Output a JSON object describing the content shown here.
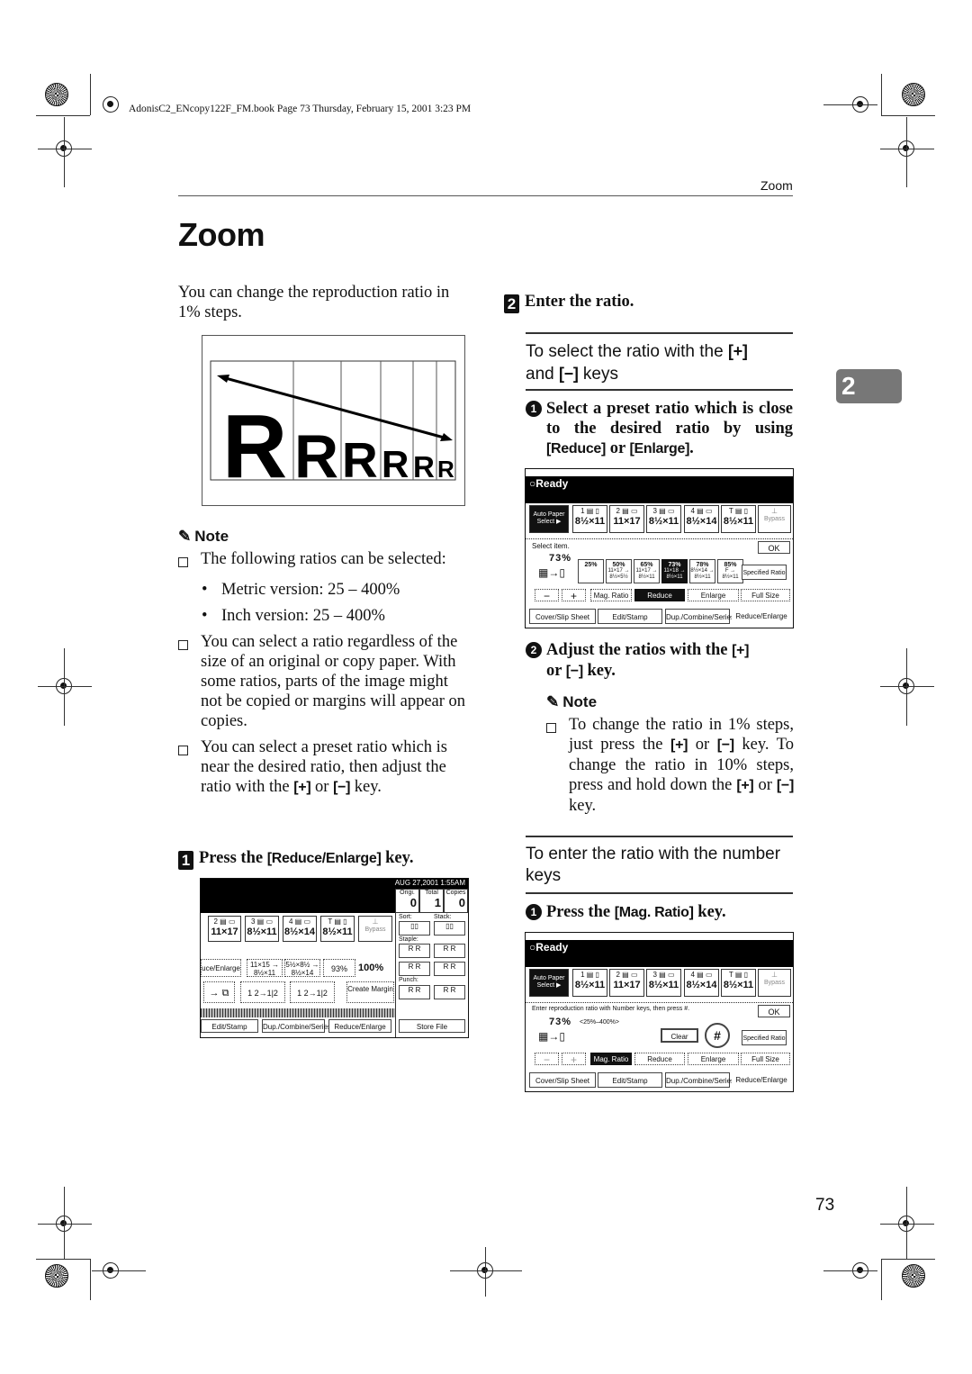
{
  "page": {
    "header_meta": "AdonisC2_ENcopy122F_FM.book  Page 73  Thursday, February 15, 2001  3:23 PM",
    "running_head": "Zoom",
    "title": "Zoom",
    "chapter_tab": "2",
    "page_number": "73"
  },
  "left": {
    "intro": "You can change the reproduction ratio in 1% steps.",
    "figure": {
      "letters": [
        "R",
        "R",
        "R",
        "R",
        "R",
        "R"
      ],
      "icon": "double-arrow-icon"
    },
    "note": {
      "heading": "Note",
      "items": [
        {
          "text": "The following ratios can be selected:",
          "bullets": [
            "Metric version: 25 – 400%",
            "Inch version: 25 – 400%"
          ]
        },
        {
          "text": "You can select a ratio regardless of the size of an original or copy paper. With some ratios, parts of the image might not be copied or margins will appear on copies."
        },
        {
          "pre": "You can select a preset ratio which is near the desired ratio, then adjust the ratio with the ",
          "plus": "[+]",
          "mid": " or ",
          "minus": "[−]",
          "post": " key."
        }
      ]
    },
    "step1": {
      "num": "1",
      "pre": "Press the ",
      "key": "[Reduce/Enlarge]",
      "post": " key."
    },
    "panel1": {
      "date": "AUG  27,2001   1:55AM",
      "counters": [
        {
          "label": "Origi.",
          "value": "0"
        },
        {
          "label": "Total",
          "value": "1"
        },
        {
          "label": "Copies",
          "value": "0"
        }
      ],
      "trays": [
        {
          "id": "2",
          "size": "11×17"
        },
        {
          "id": "3",
          "size": "8½×11"
        },
        {
          "id": "4",
          "size": "8½×14"
        },
        {
          "id": "T",
          "size": "8½×11"
        },
        {
          "id": "",
          "size": "Bypass"
        }
      ],
      "ratio_row": [
        "uce/Enlarge",
        "11×15 → 8½×11",
        "5½×8½ → 8½×14",
        "93%",
        "100%"
      ],
      "func_row": [
        "Create Margin"
      ],
      "sort_label": "Sort:",
      "stack_label": "Stack:",
      "staple_label": "Staple:",
      "punch_label": "Punch:",
      "tabs": [
        "Edit/Stamp",
        "Dup./Combine/Series",
        "Reduce/Enlarge"
      ],
      "store": "Store File"
    }
  },
  "right": {
    "step2": {
      "num": "2",
      "text": "Enter the ratio."
    },
    "section1": {
      "heading_pre": "To select the ratio with the ",
      "plus": "[+]",
      "heading_mid": " and ",
      "minus": "[−]",
      "heading_post": " keys",
      "sub1": {
        "num": "1",
        "pre": "Select a preset ratio which is close to the desired ratio by using ",
        "k1": "[Reduce]",
        "mid": " or ",
        "k2": "[Enlarge]",
        "post": "."
      },
      "sub2": {
        "num": "2",
        "pre": "Adjust the ratios with the ",
        "plus": "[+]",
        "mid": " or ",
        "minus": "[−]",
        "post": " key."
      },
      "note": {
        "heading": "Note",
        "text_parts": [
          "To change the ratio in 1% steps, just press the ",
          "[+]",
          " or ",
          "[−]",
          " key. To change the ratio in 10% steps, press and hold down the ",
          "[+]",
          " or ",
          "[−]",
          " key."
        ]
      }
    },
    "section2": {
      "heading": "To enter the ratio with the number keys",
      "sub1": {
        "num": "1",
        "pre": "Press the ",
        "key": "[Mag. Ratio]",
        "post": " key."
      }
    },
    "panel2": {
      "status": "Ready",
      "auto_paper": "Auto Paper Select ▶",
      "trays": [
        {
          "id": "1",
          "size": "8½×11"
        },
        {
          "id": "2",
          "size": "11×17"
        },
        {
          "id": "3",
          "size": "8½×11"
        },
        {
          "id": "4",
          "size": "8½×14"
        },
        {
          "id": "T",
          "size": "8½×11"
        },
        {
          "id": "",
          "size": "Bypass"
        }
      ],
      "prompt": "Select item.",
      "ok": "OK",
      "ratio": "73%",
      "presets": [
        {
          "pct": "25%",
          "sub": ""
        },
        {
          "pct": "50%",
          "sub": "11×17 → 8½×5½"
        },
        {
          "pct": "65%",
          "sub": "11×17 → 8½×11"
        },
        {
          "pct": "73%",
          "sub": "11×18 → 8½×11",
          "selected": true
        },
        {
          "pct": "78%",
          "sub": "8½×14 → 8½×11"
        },
        {
          "pct": "85%",
          "sub": "F → 8½×11"
        }
      ],
      "specified": "Specified Ratio",
      "minus": "−",
      "plus": "+",
      "mode_buttons": [
        "Mag. Ratio",
        "Reduce",
        "Enlarge",
        "Full Size"
      ],
      "active_mode": "Reduce",
      "tabs": [
        "Cover/Slip Sheet",
        "Edit/Stamp",
        "Dup./Combine/Series",
        "Reduce/Enlarge"
      ]
    },
    "panel3": {
      "status": "Ready",
      "auto_paper": "Auto Paper Select ▶",
      "trays": [
        {
          "id": "1",
          "size": "8½×11"
        },
        {
          "id": "2",
          "size": "11×17"
        },
        {
          "id": "3",
          "size": "8½×11"
        },
        {
          "id": "4",
          "size": "8½×14"
        },
        {
          "id": "T",
          "size": "8½×11"
        },
        {
          "id": "",
          "size": "Bypass"
        }
      ],
      "prompt": "Enter reproduction ratio with Number keys, then press #.",
      "ok": "OK",
      "ratio": "73%",
      "range": "<25%–400%>",
      "clear": "Clear",
      "hash": "#",
      "specified": "Specified Ratio",
      "minus": "−",
      "plus": "+",
      "mode_buttons": [
        "Mag. Ratio",
        "Reduce",
        "Enlarge",
        "Full Size"
      ],
      "active_mode": "Mag. Ratio",
      "tabs": [
        "Cover/Slip Sheet",
        "Edit/Stamp",
        "Dup./Combine/Series",
        "Reduce/Enlarge"
      ]
    }
  }
}
